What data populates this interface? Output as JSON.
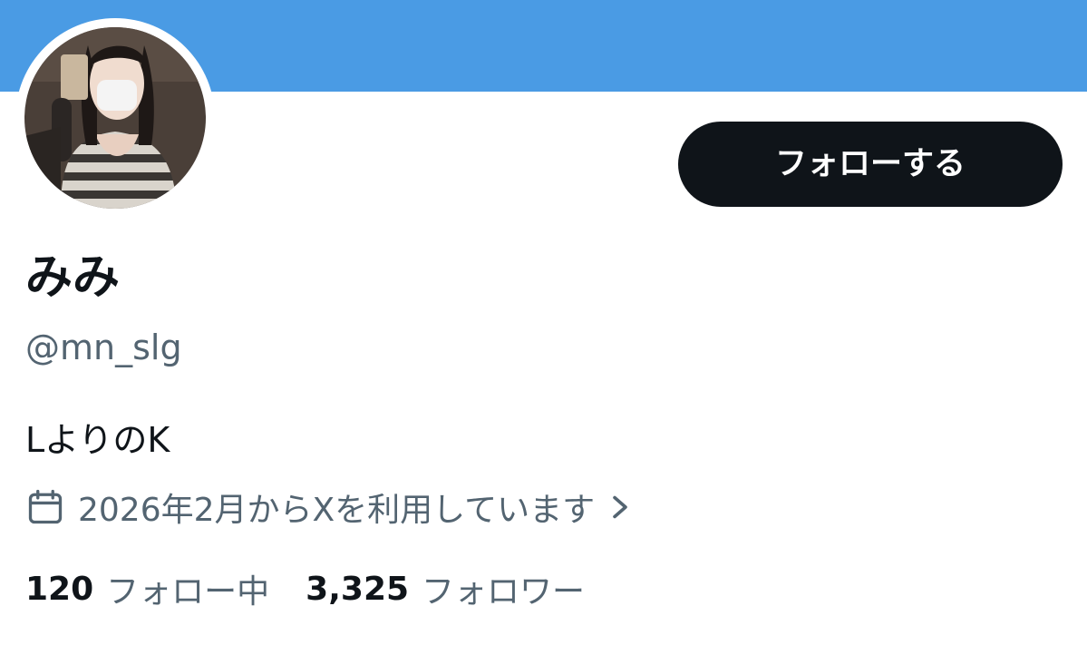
{
  "header": {
    "banner_color": "#4a9be4"
  },
  "profile": {
    "avatar_icon": "profile-photo",
    "follow_button_label": "フォローする",
    "display_name": "みみ",
    "handle": "@mn_slg",
    "bio": "LよりのK",
    "joined": {
      "icon": "calendar-icon",
      "text": "2026年2月からXを利用しています",
      "chevron_icon": "chevron-right-icon"
    },
    "stats": {
      "following_count": "120",
      "following_label": "フォロー中",
      "followers_count": "3,325",
      "followers_label": "フォロワー"
    }
  },
  "colors": {
    "text_primary": "#0f1419",
    "text_secondary": "#536471",
    "button_bg": "#0f1419"
  }
}
